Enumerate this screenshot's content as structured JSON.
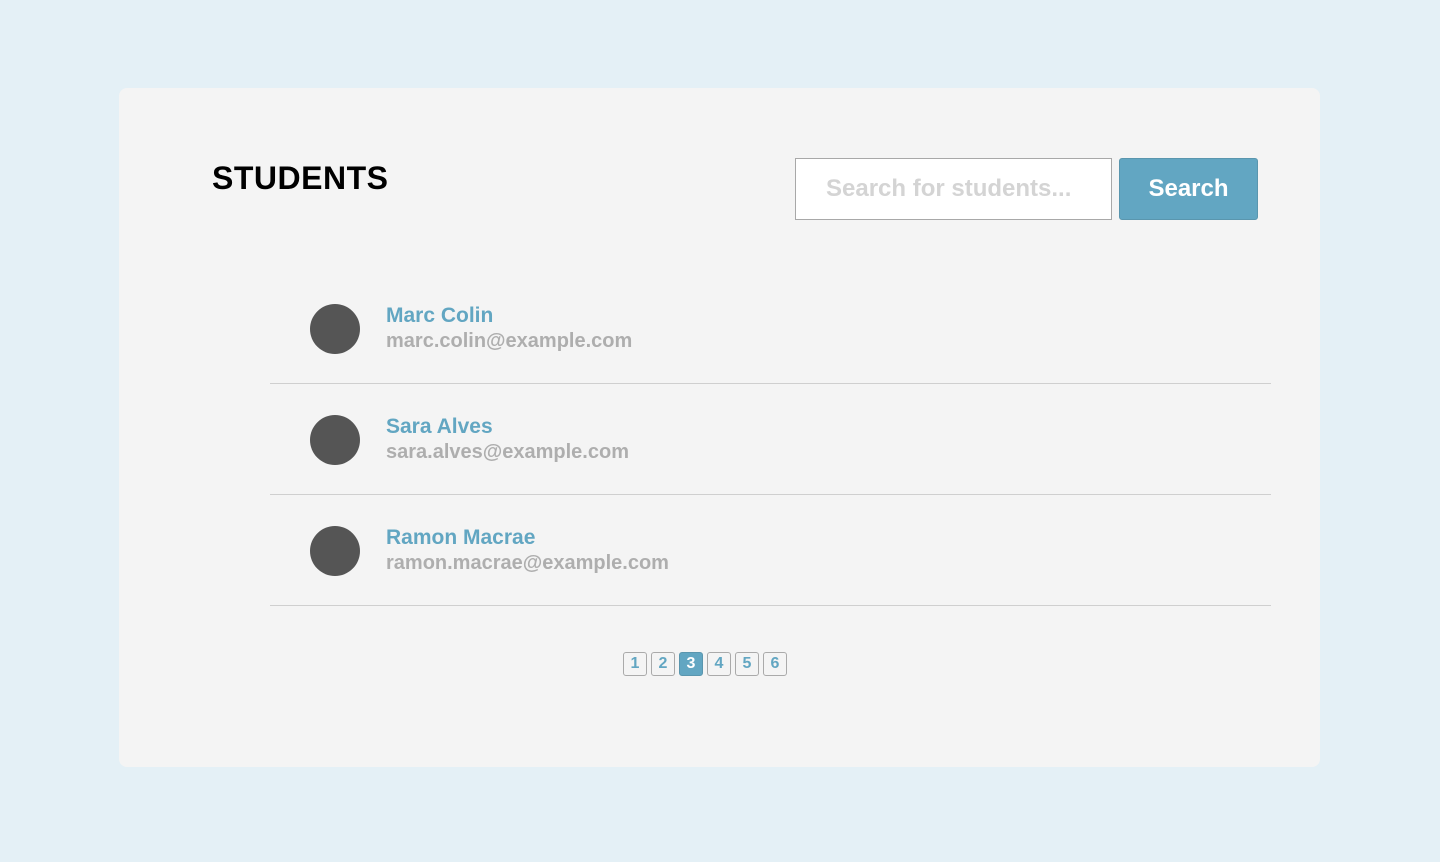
{
  "header": {
    "title": "STUDENTS"
  },
  "search": {
    "placeholder": "Search for students...",
    "value": "",
    "button_label": "Search"
  },
  "students": [
    {
      "name": "Marc Colin",
      "email": "marc.colin@example.com"
    },
    {
      "name": "Sara Alves",
      "email": "sara.alves@example.com"
    },
    {
      "name": "Ramon Macrae",
      "email": "ramon.macrae@example.com"
    }
  ],
  "pagination": {
    "pages": [
      "1",
      "2",
      "3",
      "4",
      "5",
      "6"
    ],
    "current": "3"
  },
  "colors": {
    "accent": "#62a6c2",
    "page_background": "#e4f0f6",
    "card_background": "#f4f4f4",
    "avatar": "#555555",
    "email_text": "#aeaeae"
  }
}
